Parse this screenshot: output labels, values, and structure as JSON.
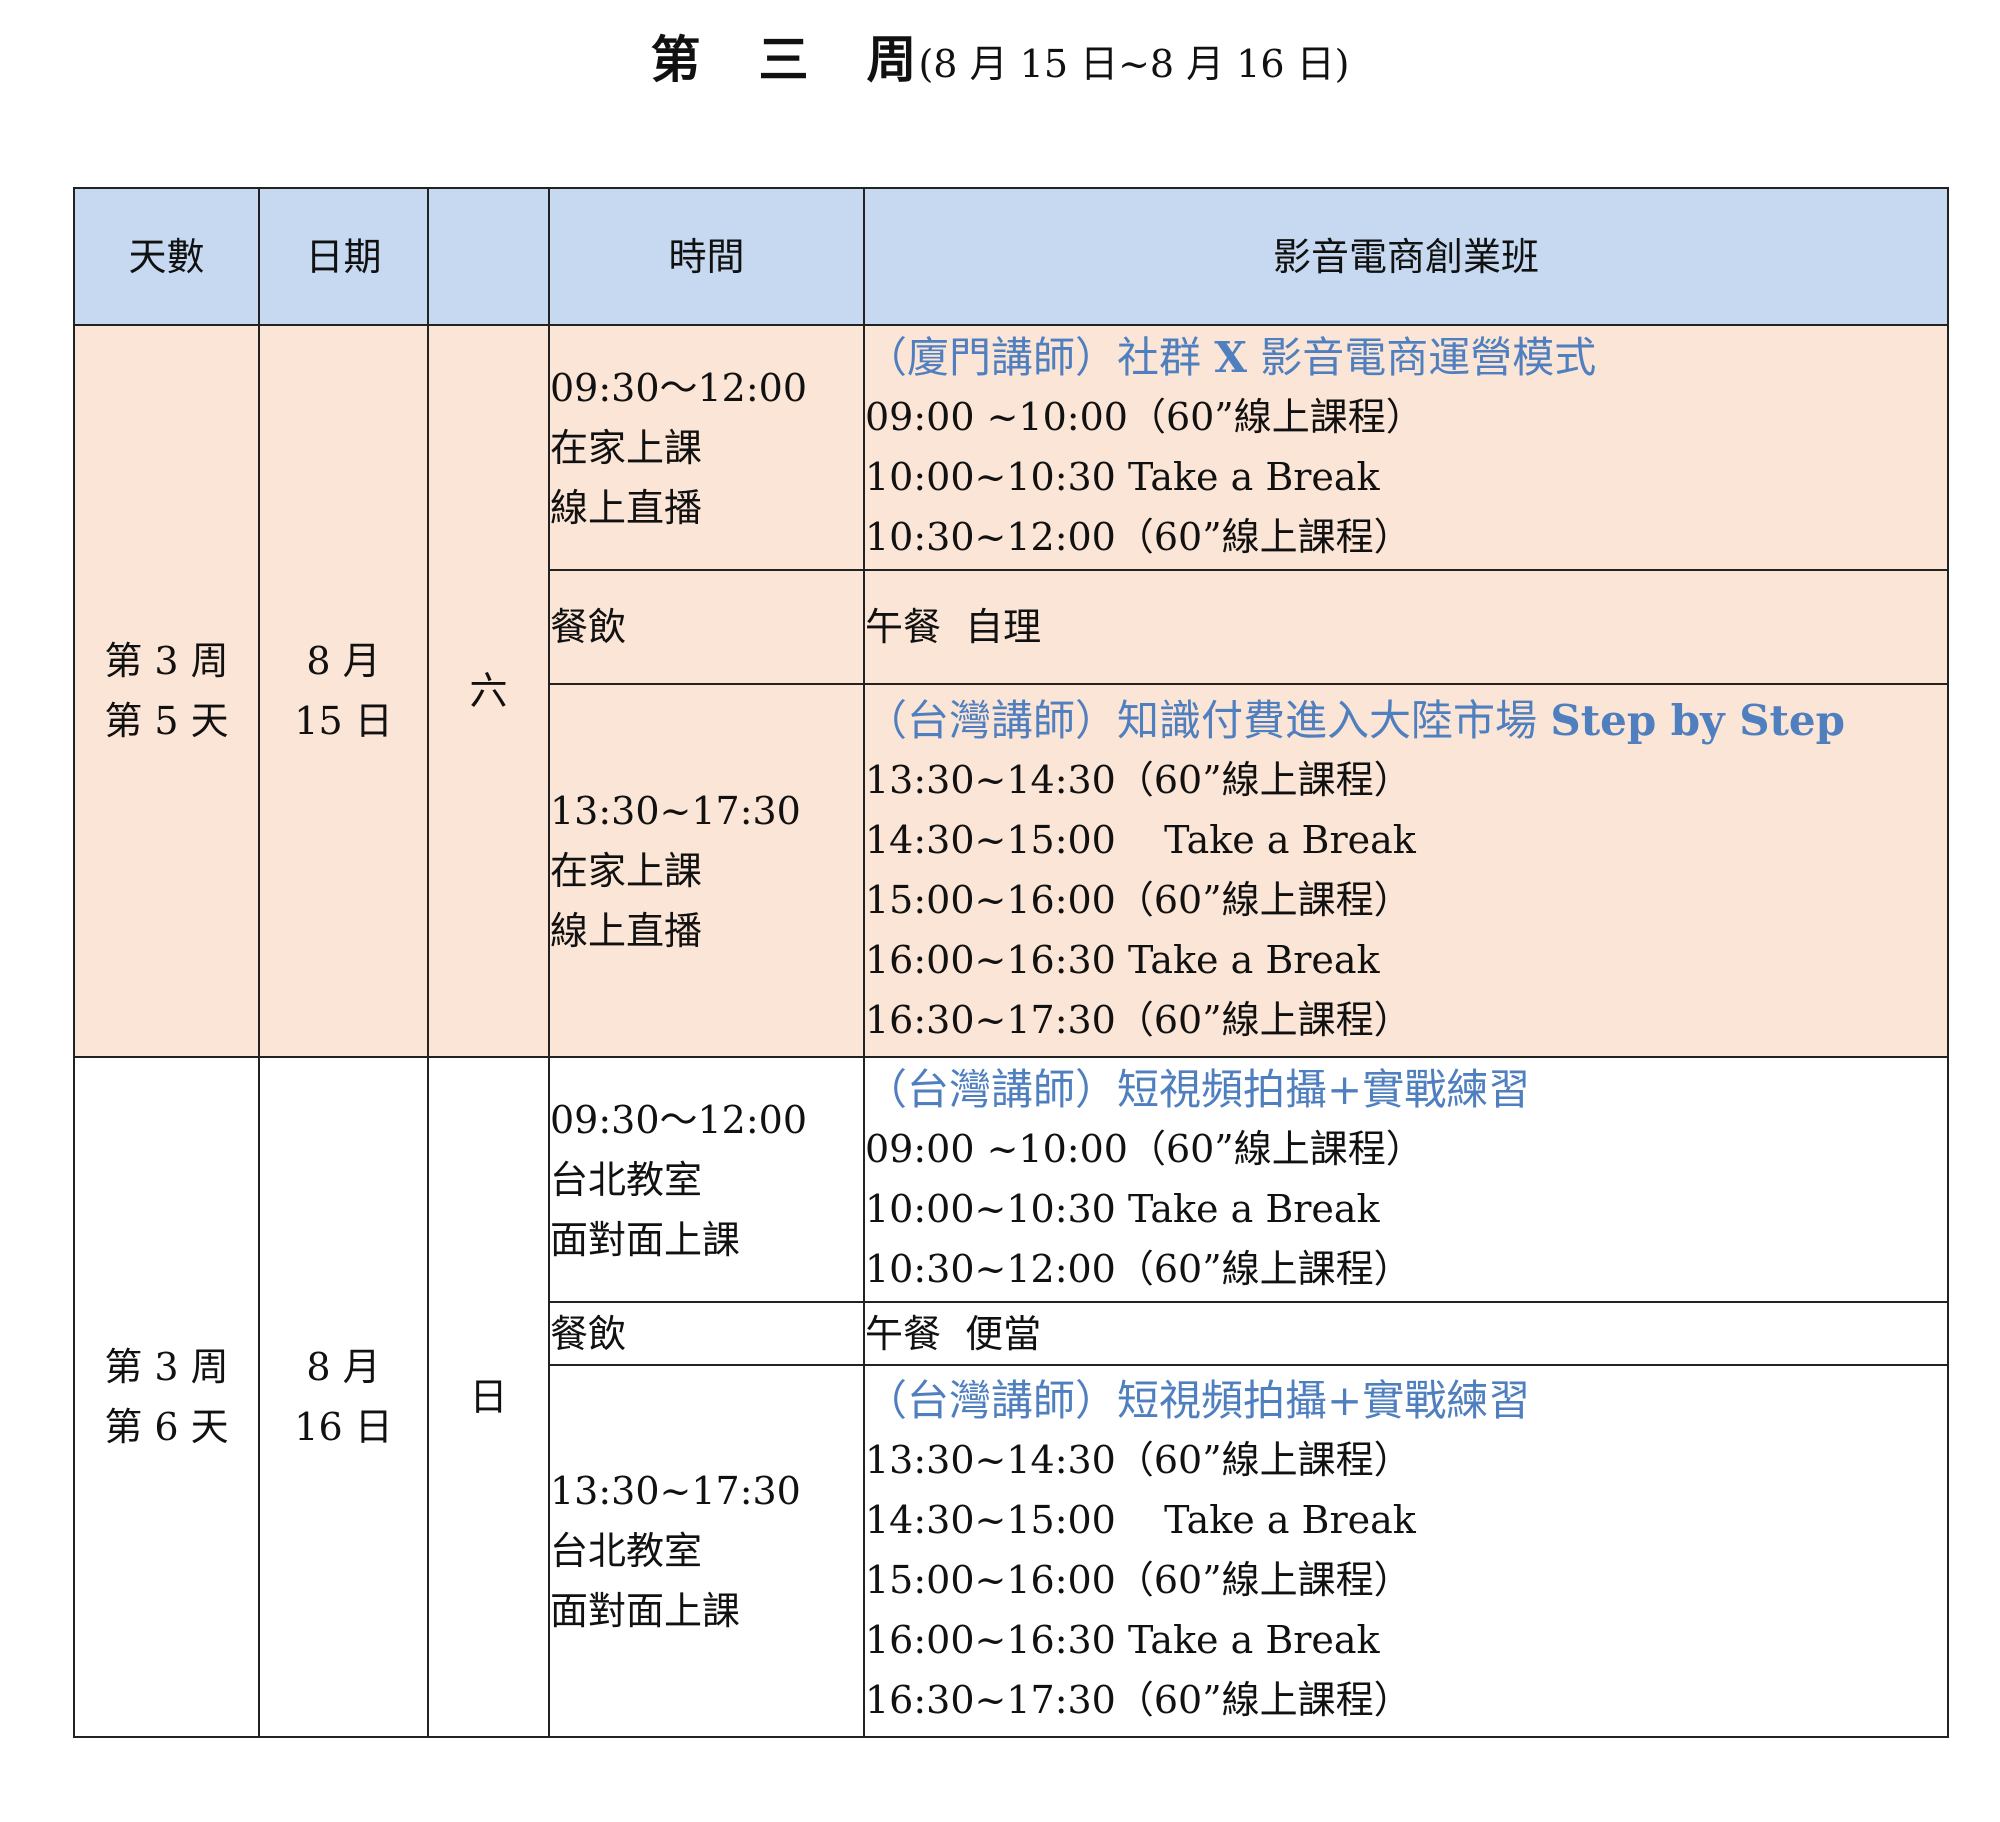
{
  "title": {
    "parts": [
      "第",
      "三",
      "周"
    ],
    "range": "(8 月 15 日~8 月 16 日)"
  },
  "header": {
    "days": "天數",
    "date": "日期",
    "weekday": "",
    "time": "時間",
    "program": "影音電商創業班"
  },
  "day5": {
    "label_line1": "第 3 周",
    "label_line2": "第 5 天",
    "date_line1": "8 月",
    "date_line2": "15 日",
    "weekday": "六",
    "morning": {
      "time": "09:30～12:00",
      "place": "在家上課",
      "mode": "線上直播",
      "course_prefix": "（廈門講師）社群 ",
      "course_bold": "X",
      "course_suffix": " 影音電商運營模式",
      "lines": [
        "09:00 ~10:00（60”線上課程）",
        "10:00~10:30 Take a Break",
        "10:30~12:00（60”線上課程）"
      ]
    },
    "lunch": {
      "label": "餐飲",
      "detail": "午餐  自理"
    },
    "afternoon": {
      "time": "13:30~17:30",
      "place": "在家上課",
      "mode": "線上直播",
      "course_prefix": "（台灣講師）知識付費進入大陸市場 ",
      "course_bold": "Step by Step",
      "course_suffix": "",
      "lines": [
        "13:30~14:30（60”線上課程）",
        "14:30~15:00    Take a Break",
        "15:00~16:00（60”線上課程）",
        "16:00~16:30 Take a Break",
        "16:30~17:30（60”線上課程）"
      ]
    }
  },
  "day6": {
    "label_line1": "第 3 周",
    "label_line2": "第 6 天",
    "date_line1": "8 月",
    "date_line2": "16 日",
    "weekday": "日",
    "morning": {
      "time": "09:30～12:00",
      "place": "台北教室",
      "mode": "面對面上課",
      "course": "（台灣講師）短視頻拍攝+實戰練習",
      "lines": [
        "09:00 ~10:00（60”線上課程）",
        "10:00~10:30 Take a Break",
        "10:30~12:00（60”線上課程）"
      ]
    },
    "lunch": {
      "label": "餐飲",
      "detail": "午餐  便當"
    },
    "afternoon": {
      "time": "13:30~17:30",
      "place": "台北教室",
      "mode": "面對面上課",
      "course": "（台灣講師）短視頻拍攝+實戰練習",
      "lines": [
        "13:30~14:30（60”線上課程）",
        "14:30~15:00    Take a Break",
        "15:00~16:00（60”線上課程）",
        "16:00~16:30 Take a Break",
        "16:30~17:30（60”線上課程）"
      ]
    }
  }
}
